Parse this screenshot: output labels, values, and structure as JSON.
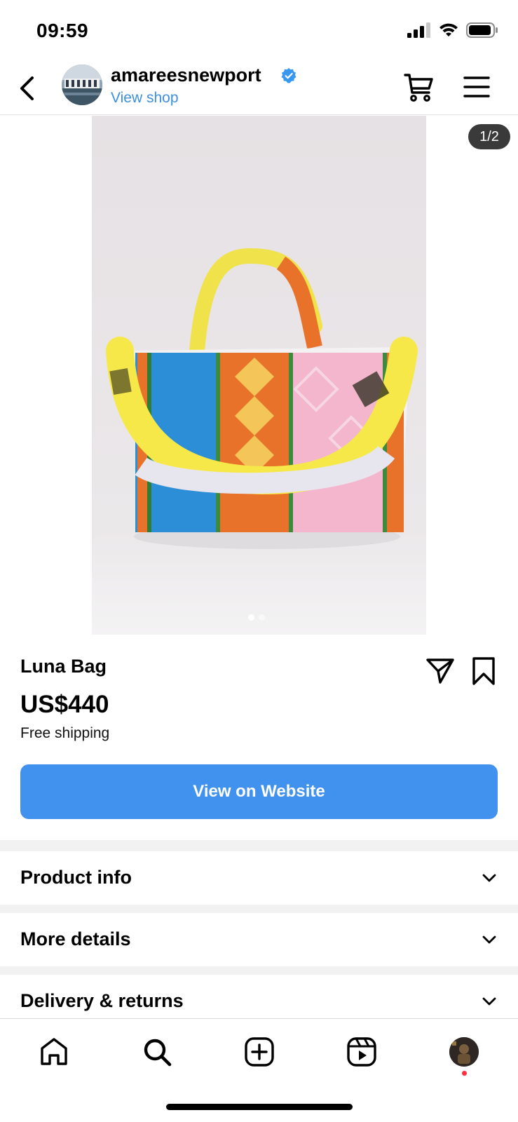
{
  "status_bar": {
    "time": "09:59"
  },
  "header": {
    "account_name": "amareesnewport",
    "view_shop": "View shop",
    "verified": true
  },
  "product": {
    "image_counter": "1/2",
    "image_count": 2,
    "active_image": 1,
    "title": "Luna Bag",
    "price": "US$440",
    "shipping": "Free shipping",
    "cta_label": "View on Website"
  },
  "sections": [
    {
      "label": "Product info"
    },
    {
      "label": "More details"
    },
    {
      "label": "Delivery & returns"
    }
  ],
  "nav": {
    "items": [
      "home-icon",
      "search-icon",
      "create-icon",
      "reels-icon",
      "profile-avatar"
    ],
    "notification_dot": true
  },
  "colors": {
    "accent": "#4192ef",
    "link": "#3d8fe0",
    "verified": "#3897f0",
    "notification": "#ff3040"
  }
}
